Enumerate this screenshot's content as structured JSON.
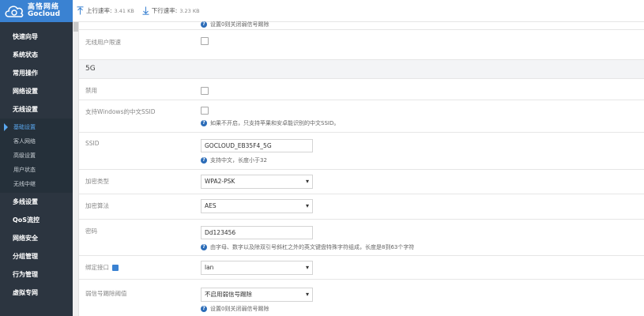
{
  "brand": {
    "name_cn": "高恪网络",
    "name_en": "Gocloud",
    "color": "#3a82d2"
  },
  "topbar": {
    "upload_label": "上行速率:",
    "upload_value": "3.41 KB",
    "download_label": "下行速率:",
    "download_value": "3.23 KB"
  },
  "sidebar": {
    "items": [
      {
        "label": "快速向导"
      },
      {
        "label": "系统状态"
      },
      {
        "label": "常用操作"
      },
      {
        "label": "网络设置"
      },
      {
        "label": "无线设置"
      }
    ],
    "submenu": [
      {
        "label": "基础设置",
        "active": true
      },
      {
        "label": "客人网络"
      },
      {
        "label": "高级设置"
      },
      {
        "label": "用户状态"
      },
      {
        "label": "无线中继"
      }
    ],
    "items_after": [
      {
        "label": "多线设置"
      },
      {
        "label": "QoS流控"
      },
      {
        "label": "网络安全"
      },
      {
        "label": "分组管理"
      },
      {
        "label": "行为管理"
      },
      {
        "label": "虚拟专网"
      }
    ],
    "cut_label": "高级设置"
  },
  "content": {
    "top_hint": "设置0则关闭弱信号踢除",
    "no_limit_label": "无线用户限速",
    "section_5g": "5G",
    "disable_label": "禁用",
    "windows_ssid_label": "支持Windows的中文SSID",
    "windows_ssid_hint": "如果不开启，只支持苹果和安卓能识别的中文SSID。",
    "ssid_label": "SSID",
    "ssid_value": "GOCLOUD_EB35F4_5G",
    "ssid_hint": "支持中文，长度小于32",
    "encrypt_type_label": "加密类型",
    "encrypt_type_value": "WPA2-PSK",
    "encrypt_algo_label": "加密算法",
    "encrypt_algo_value": "AES",
    "password_label": "密码",
    "password_value": "Dd123456",
    "password_hint": "由字母、数字以及除双引号斜杠之外的英文键盘特殊字符组成，长度是8到63个字符",
    "bind_iface_label": "绑定接口",
    "bind_iface_value": "lan",
    "weak_kick_label": "弱信号踢除阈值",
    "weak_kick_value": "不启用弱信号踢除",
    "weak_kick_hint": "设置0则关闭弱信号踢除"
  }
}
